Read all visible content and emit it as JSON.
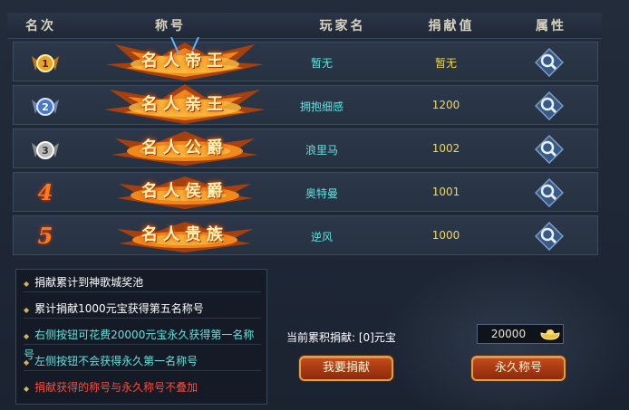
{
  "headers": [
    "名次",
    "称号",
    "玩家名",
    "捐献值",
    "属性"
  ],
  "rows": [
    {
      "rank": "1",
      "title": "名人帝王",
      "player": "暂无",
      "contribution": "暂无"
    },
    {
      "rank": "2",
      "title": "名人亲王",
      "player": "拥抱细感",
      "contribution": "1200"
    },
    {
      "rank": "3",
      "title": "名人公爵",
      "player": "浪里马",
      "contribution": "1002"
    },
    {
      "rank": "4",
      "title": "名人侯爵",
      "player": "奥特曼",
      "contribution": "1001"
    },
    {
      "rank": "5",
      "title": "名人贵族",
      "player": "逆风",
      "contribution": "1000"
    }
  ],
  "info": [
    {
      "text": "捐献累计到神歌城奖池",
      "color": "#ffffff"
    },
    {
      "text": "累计捐献1000元宝获得第五名称号",
      "color": "#ffffff"
    },
    {
      "text": "右侧按钮可花费20000元宝永久获得第一名称号",
      "color": "#5fe3e0"
    },
    {
      "text": "左侧按钮不会获得永久第一名称号",
      "color": "#5fe3e0"
    },
    {
      "text": "捐献获得的称号与永久称号不叠加",
      "color": "#ff4a3a"
    }
  ],
  "current_label": "当前累积捐献: [0]元宝",
  "amount": "20000",
  "buttons": {
    "donate": "我要捐献",
    "permanent": "永久称号"
  },
  "colors": {
    "player": "#5fe3e0",
    "contribution": "#f2d84a",
    "accent": "#c64b1b"
  }
}
